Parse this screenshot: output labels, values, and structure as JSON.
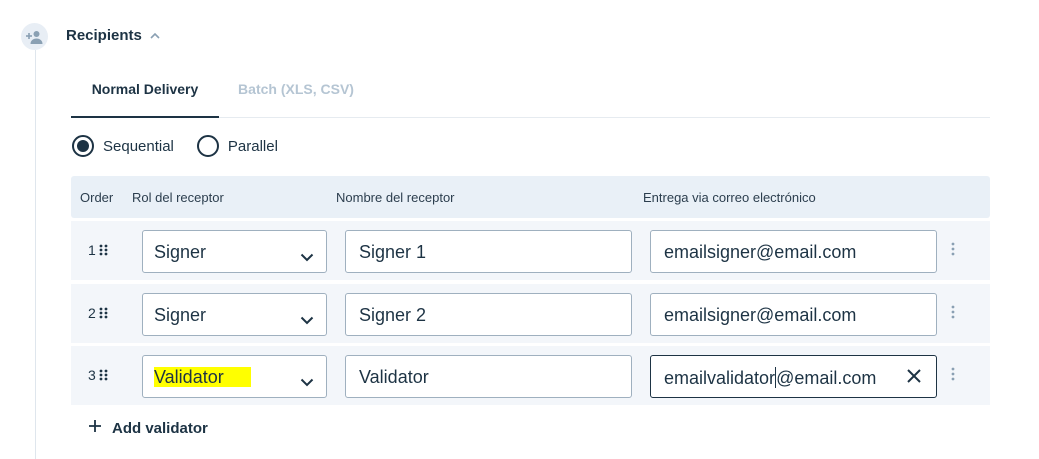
{
  "section": {
    "title": "Recipients",
    "icon": "add-person-icon"
  },
  "tabs": [
    {
      "label": "Normal Delivery",
      "active": true
    },
    {
      "label": "Batch (XLS, CSV)",
      "active": false
    }
  ],
  "delivery_mode": {
    "options": [
      {
        "label": "Sequential",
        "selected": true
      },
      {
        "label": "Parallel",
        "selected": false
      }
    ]
  },
  "table": {
    "headers": {
      "order": "Order",
      "role": "Rol del receptor",
      "name": "Nombre del receptor",
      "email": "Entrega via correo electrónico"
    },
    "rows": [
      {
        "order": "1",
        "role": "Signer",
        "name": "Signer 1",
        "email": "emailsigner@email.com"
      },
      {
        "order": "2",
        "role": "Signer",
        "name": "Signer 2",
        "email": "emailsigner@email.com"
      },
      {
        "order": "3",
        "role": "Validator",
        "name": "Validator",
        "email_before_caret": "emailvalidator",
        "email_after_caret": "@email.com",
        "role_highlight": "#ffff00"
      }
    ]
  },
  "add_validator": {
    "label": "Add validator"
  },
  "colors": {
    "text": "#1d3344",
    "muted_tab": "#b5c5d3",
    "header_bg": "#e9f0f7",
    "row_bg": "#f3f6fa",
    "highlight": "#ffff00"
  }
}
